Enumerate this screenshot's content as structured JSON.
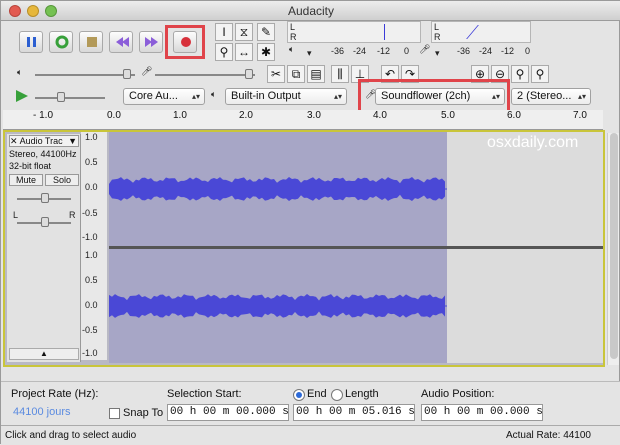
{
  "window": {
    "title": "Audacity"
  },
  "transport": {
    "buttons": [
      "pause-button",
      "play-button",
      "stop-button",
      "skip-start-button",
      "skip-end-button",
      "record-button"
    ]
  },
  "meters": {
    "left_label": "L",
    "right_label": "R",
    "db_ticks": [
      "-36",
      "-24",
      "-12",
      "0"
    ],
    "db_ticks_right": [
      "-36",
      "-24",
      "-12",
      "0"
    ]
  },
  "devices": {
    "host": "Core Au...",
    "output": "Built-in Output",
    "input": "Soundflower (2ch)",
    "channels": "2 (Stereo..."
  },
  "ruler": {
    "ticks": [
      "- 1.0",
      "0.0",
      "1.0",
      "2.0",
      "3.0",
      "4.0",
      "5.0",
      "6.0",
      "7.0"
    ]
  },
  "track": {
    "name": "Audio Trac",
    "info1": "Stereo, 44100Hz",
    "info2": "32-bit float",
    "mute": "Mute",
    "solo": "Solo",
    "gain_left": "L",
    "gain_right": "R",
    "scale": [
      "1.0",
      "0.5",
      "0.0",
      "-0.5",
      "-1.0"
    ],
    "scale2": [
      "1.0",
      "0.5",
      "0.0",
      "-0.5",
      "-1.0"
    ]
  },
  "watermark": "osxdaily.com",
  "bottom": {
    "project_rate_label": "Project Rate (Hz):",
    "project_rate_value": "44100 jours",
    "snap_label": "Snap To",
    "selection_start_label": "Selection Start:",
    "end_label": "End",
    "length_label": "Length",
    "selection_start": "00 h 00 m 00.000 s",
    "selection_end": "00 h 00 m 05.016 s",
    "audio_position_label": "Audio Position:",
    "audio_position": "00 h 00 m 00.000 s"
  },
  "status": {
    "hint": "Click and drag to select audio",
    "actual_rate": "Actual Rate: 44100"
  },
  "colors": {
    "record_highlight": "#e0444a",
    "selection": "#a7a6c6",
    "waveform": "#4a48d6"
  }
}
